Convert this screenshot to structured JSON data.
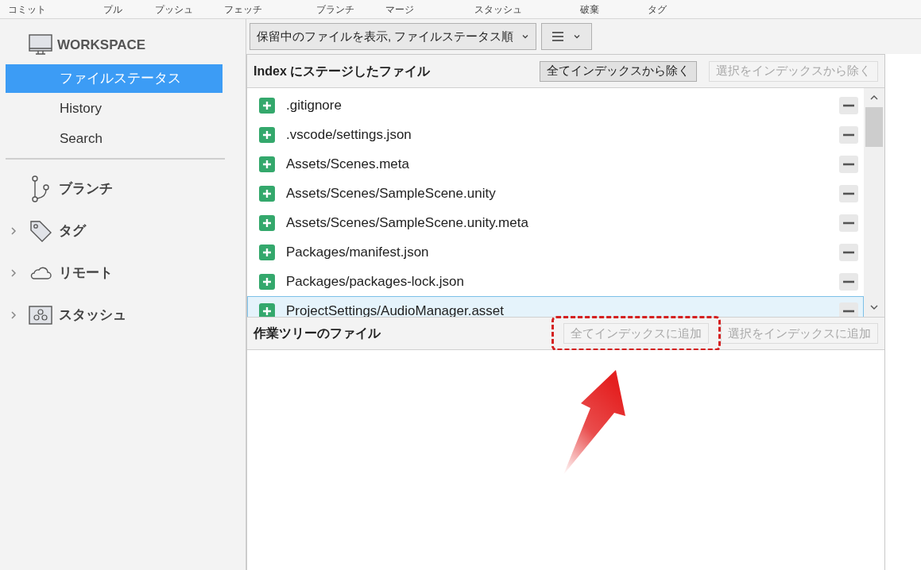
{
  "toolbar": [
    "コミット",
    "プル",
    "プッシュ",
    "フェッチ",
    "ブランチ",
    "マージ",
    "スタッシュ",
    "破棄",
    "タグ"
  ],
  "sidebar": {
    "workspace": {
      "title": "WORKSPACE",
      "items": [
        {
          "label": "ファイルステータス",
          "selected": true
        },
        {
          "label": "History",
          "selected": false
        },
        {
          "label": "Search",
          "selected": false
        }
      ]
    },
    "sections": [
      {
        "kind": "branch",
        "label": "ブランチ",
        "expandable": false
      },
      {
        "kind": "tag",
        "label": "タグ",
        "expandable": true
      },
      {
        "kind": "remote",
        "label": "リモート",
        "expandable": true
      },
      {
        "kind": "stash",
        "label": "スタッシュ",
        "expandable": true
      }
    ]
  },
  "view_dropdown": {
    "label": "保留中のファイルを表示, ファイルステータス順"
  },
  "staged": {
    "title": "Index にステージしたファイル",
    "buttons": [
      {
        "label": "全てインデックスから除く",
        "disabled": false
      },
      {
        "label": "選択をインデックスから除く",
        "disabled": true
      }
    ],
    "files": [
      {
        "path": ".gitignore",
        "selected": false
      },
      {
        "path": ".vscode/settings.json",
        "selected": false
      },
      {
        "path": "Assets/Scenes.meta",
        "selected": false
      },
      {
        "path": "Assets/Scenes/SampleScene.unity",
        "selected": false
      },
      {
        "path": "Assets/Scenes/SampleScene.unity.meta",
        "selected": false
      },
      {
        "path": "Packages/manifest.json",
        "selected": false
      },
      {
        "path": "Packages/packages-lock.json",
        "selected": false
      },
      {
        "path": "ProjectSettings/AudioManager.asset",
        "selected": true
      }
    ]
  },
  "working": {
    "title": "作業ツリーのファイル",
    "buttons": [
      {
        "label": "全てインデックスに追加",
        "disabled": true,
        "highlighted": true
      },
      {
        "label": "選択をインデックスに追加",
        "disabled": true,
        "highlighted": false
      }
    ]
  }
}
